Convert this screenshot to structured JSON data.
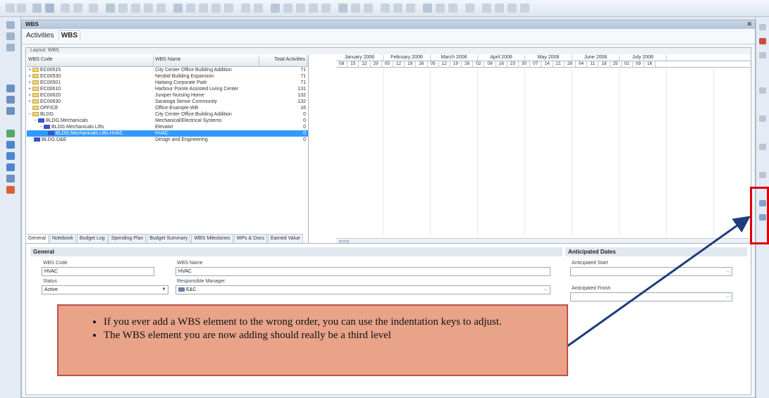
{
  "window": {
    "title": "WBS",
    "tabs": [
      "Activities",
      "WBS"
    ]
  },
  "layout_label": "Layout: WBS",
  "grid": {
    "columns": [
      "WBS Code",
      "WBS Name",
      "Total Activities"
    ],
    "rows": [
      {
        "code": "EC00515",
        "name": "City Center Office Building Addition",
        "total": "71"
      },
      {
        "code": "EC00530",
        "name": "Nesbid Building Expansion",
        "total": "71"
      },
      {
        "code": "EC00501",
        "name": "Haitang Corporate Park",
        "total": "71"
      },
      {
        "code": "EC00610",
        "name": "Harbour Pointe Assisted Living Center",
        "total": "131"
      },
      {
        "code": "EC00620",
        "name": "Juniper Nursing Home",
        "total": "132"
      },
      {
        "code": "EC00630",
        "name": "Saratoga Senior Community",
        "total": "132"
      },
      {
        "code": "OFFICE",
        "name": "Office-Example-WB",
        "total": "16"
      },
      {
        "code": "BLDG",
        "name": "City Center Office Building Addition",
        "total": "0"
      },
      {
        "code": "BLDG.Mechanicals",
        "name": "Mechanical/Electrical Systems",
        "total": "0"
      },
      {
        "code": "BLDG.Mechanicals.Lifts",
        "name": "Elevator",
        "total": "0"
      },
      {
        "code": "BLDG.Mechanicals.Lifts.HVAC",
        "name": "HVAC",
        "total": "0"
      },
      {
        "code": "BLDG.D&E",
        "name": "Design and Engineering",
        "total": "0"
      }
    ]
  },
  "gantt": {
    "months": [
      "January 2006",
      "February 2006",
      "March 2006",
      "April 2006",
      "May 2006",
      "June 2006",
      "July 2006"
    ],
    "weeks": [
      "08",
      "15",
      "22",
      "29",
      "05",
      "12",
      "19",
      "26",
      "05",
      "12",
      "19",
      "26",
      "02",
      "09",
      "16",
      "23",
      "30",
      "07",
      "14",
      "21",
      "28",
      "04",
      "11",
      "18",
      "25",
      "02",
      "09",
      "16"
    ]
  },
  "detail_tabs": [
    "General",
    "Notebook",
    "Budget Log",
    "Spending Plan",
    "Budget Summary",
    "WBS Milestones",
    "WPs & Docs",
    "Earned Value"
  ],
  "general": {
    "header": "General",
    "wbs_code_label": "WBS Code",
    "wbs_code_value": "HVAC",
    "wbs_name_label": "WBS Name",
    "wbs_name_value": "HVAC",
    "status_label": "Status",
    "status_value": "Active",
    "manager_label": "Responsible Manager",
    "manager_value": "E&C"
  },
  "dates": {
    "header": "Anticipated Dates",
    "start_label": "Anticipated Start",
    "finish_label": "Anticipated Finish"
  },
  "callout": {
    "bullets": [
      "If you ever add a WBS element to the wrong order, you can use the indentation keys to adjust.",
      "The WBS element you are now adding should really be a third level"
    ]
  },
  "colors": {
    "selection": "#3399ff",
    "callout_fill": "#e8a389",
    "callout_border": "#c0504d",
    "marker": "#e00000",
    "arrow": "#1f3d7a"
  }
}
